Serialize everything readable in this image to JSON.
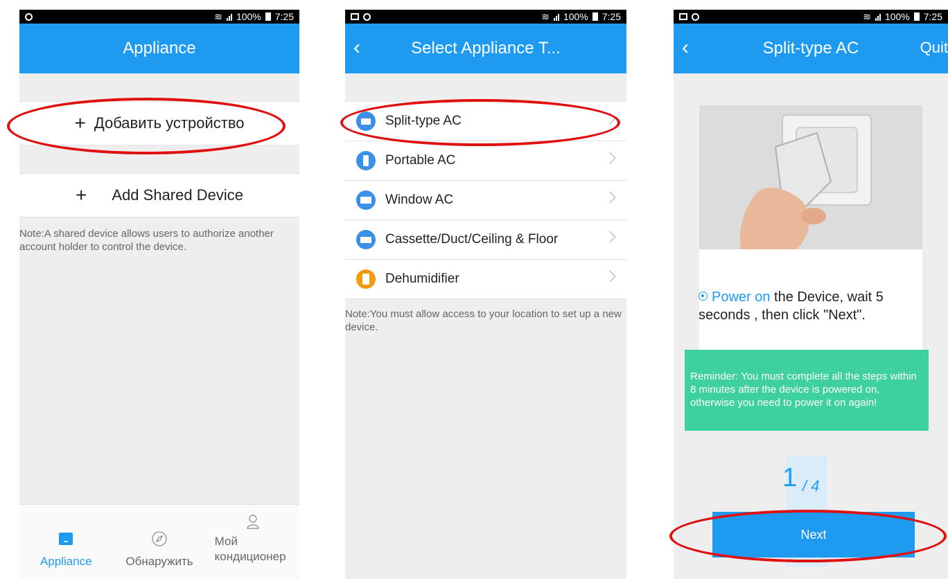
{
  "status": {
    "signal_text": "100%",
    "time": "7:25"
  },
  "screen1": {
    "title": "Appliance",
    "add_device": "Добавить устройство",
    "add_shared": "Add Shared Device",
    "note": "Note:A shared device allows users to authorize another account holder to control the device.",
    "tabs": [
      {
        "label": "Appliance"
      },
      {
        "label": "Обнаружить"
      },
      {
        "label": "Мой кондиционер"
      }
    ]
  },
  "screen2": {
    "title": "Select Appliance T...",
    "items": [
      {
        "label": "Split-type AC",
        "color": "#3a8fe6"
      },
      {
        "label": "Portable AC",
        "color": "#3a8fe6"
      },
      {
        "label": "Window AC",
        "color": "#3a8fe6"
      },
      {
        "label": "Cassette/Duct/Ceiling & Floor",
        "color": "#3a8fe6"
      },
      {
        "label": "Dehumidifier",
        "color": "#f59a10"
      }
    ],
    "note": "Note:You must allow access to your location to set up a new device."
  },
  "screen3": {
    "title": "Split-type AC",
    "quit": "Quit",
    "instruction_highlight": "Power on",
    "instruction_rest": " the Device, wait 5 seconds , then click \"Next\".",
    "reminder": "Reminder: You must complete all the steps within 8 minutes after the device is powered on, otherwise you need to power it on again!",
    "step_current": "1",
    "step_total": "/ 4",
    "next_label": "Next"
  },
  "colors": {
    "accent": "#1e9bf0",
    "reminder_bg": "#3fd0a0",
    "highlight_ring": "#e01010"
  }
}
